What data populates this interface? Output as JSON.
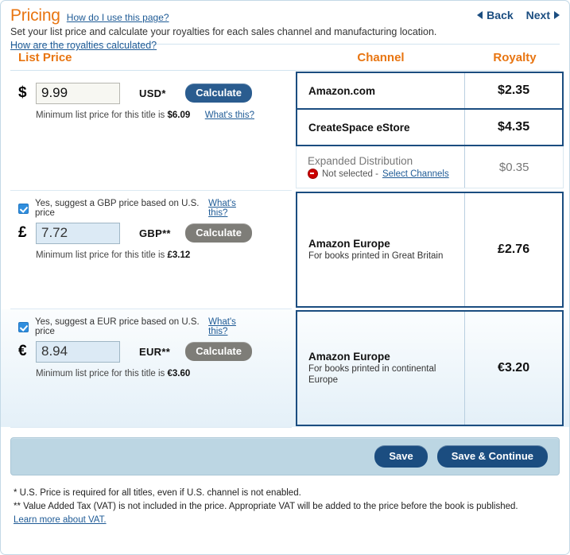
{
  "header": {
    "title": "Pricing",
    "help_link": "How do I use this page?",
    "subtitle": "Set your list price and calculate your royalties for each sales channel and manufacturing location.",
    "royalties_link": "How are the royalties calculated?",
    "back_label": "Back",
    "next_label": "Next"
  },
  "columns": {
    "list_price": "List Price",
    "channel": "Channel",
    "royalty": "Royalty"
  },
  "usd": {
    "symbol": "$",
    "value": "9.99",
    "code": "USD*",
    "calculate_label": "Calculate",
    "min_text": "Minimum list price for this title is ",
    "min_value": "$6.09",
    "whats_this": "What's this?"
  },
  "gbp": {
    "checkbox_label": "Yes, suggest a GBP price based on U.S. price",
    "checkbox_whats_this": "What's this?",
    "symbol": "£",
    "value": "7.72",
    "code": "GBP**",
    "calculate_label": "Calculate",
    "min_text": "Minimum list price for this title is ",
    "min_value": "£3.12"
  },
  "eur": {
    "checkbox_label": "Yes, suggest a EUR price based on U.S. price",
    "checkbox_whats_this": "What's this?",
    "symbol": "€",
    "value": "8.94",
    "code": "EUR**",
    "calculate_label": "Calculate",
    "min_text": "Minimum list price for this title is ",
    "min_value": "€3.60"
  },
  "channels": {
    "amazon_com": {
      "name": "Amazon.com",
      "royalty": "$2.35"
    },
    "createspace": {
      "name": "CreateSpace eStore",
      "royalty": "$4.35"
    },
    "expanded": {
      "name": "Expanded Distribution",
      "status": "Not selected -",
      "status_icon": "stop-icon",
      "select_link": "Select Channels",
      "royalty": "$0.35"
    },
    "amazon_eu_gb": {
      "name": "Amazon Europe",
      "sub": "For books printed in Great Britain",
      "royalty": "£2.76"
    },
    "amazon_eu_cont": {
      "name": "Amazon Europe",
      "sub": "For books printed in continental Europe",
      "royalty": "€3.20"
    }
  },
  "footer": {
    "save_label": "Save",
    "save_continue_label": "Save & Continue",
    "note1": "* U.S. Price is required for all titles, even if U.S. channel is not enabled.",
    "note2": "** Value Added Tax (VAT) is not included in the price. Appropriate VAT will be added to the price before the book is published.",
    "vat_link": "Learn more about VAT."
  },
  "colors": {
    "accent_orange": "#e87511",
    "link_blue": "#1f5b96",
    "table_border": "#1b4d80"
  }
}
